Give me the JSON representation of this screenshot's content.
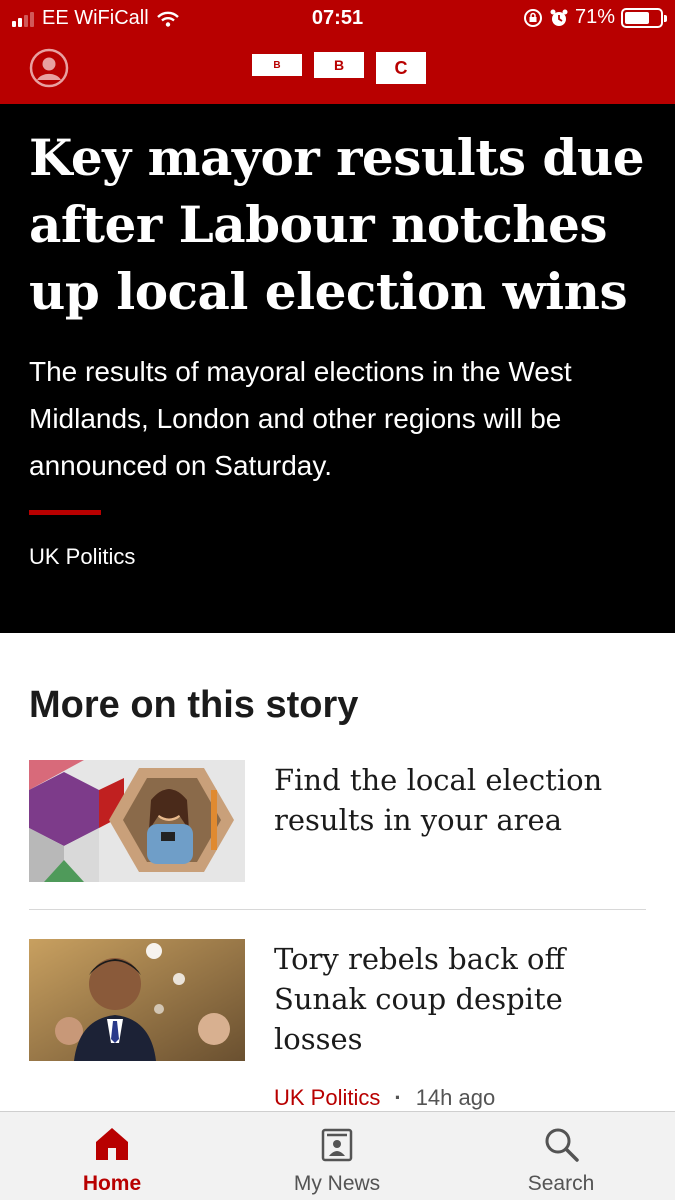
{
  "status_bar": {
    "carrier": "EE WiFiCall",
    "time": "07:51",
    "battery": "71%",
    "battery_level": 0.71
  },
  "header": {
    "logo": [
      "B",
      "B",
      "C"
    ]
  },
  "hero": {
    "headline": "Key mayor results due after Labour notches up local election wins",
    "summary": "The results of mayoral elections in the West Midlands, London and other regions will be announced on Saturday.",
    "tag": "UK Politics"
  },
  "more": {
    "title": "More on this story",
    "items": [
      {
        "headline": "Find the local election results in your area"
      },
      {
        "headline": "Tory rebels back off Sunak coup despite losses",
        "category": "UK Politics",
        "time": "14h ago"
      }
    ]
  },
  "tabbar": {
    "home": "Home",
    "my_news": "My News",
    "search": "Search"
  },
  "colors": {
    "brand": "#b80000",
    "hero_bg": "#000000",
    "tab_bg": "#f2f2f2"
  }
}
